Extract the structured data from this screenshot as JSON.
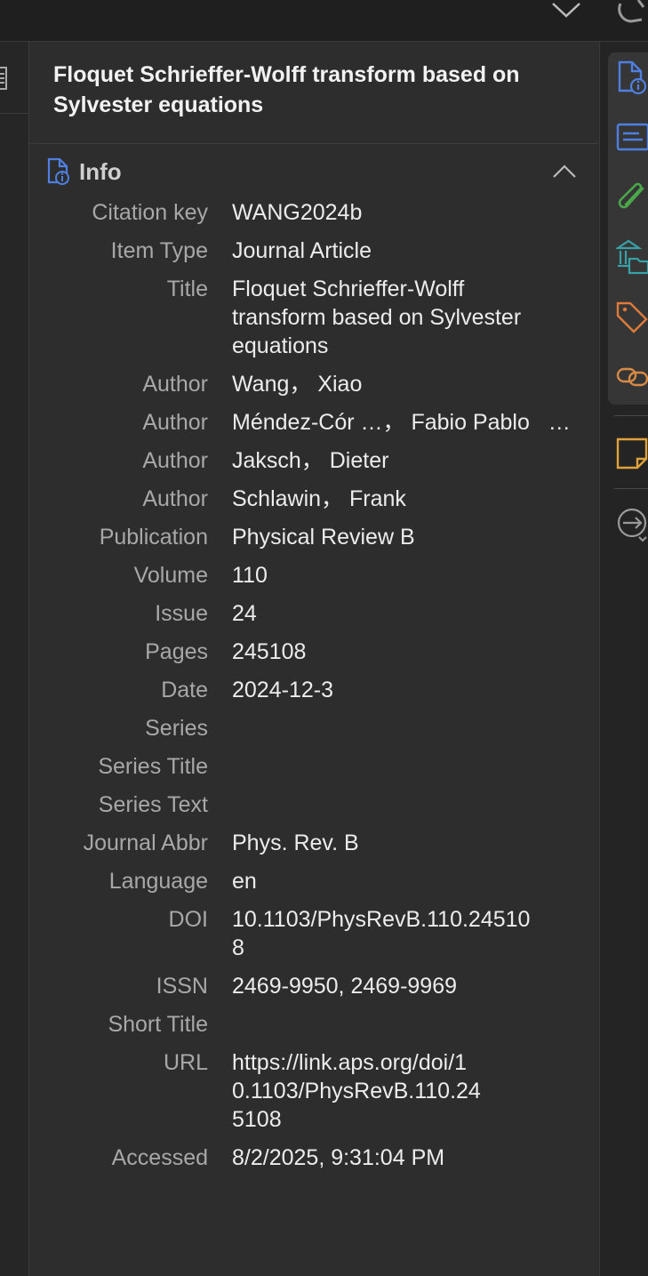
{
  "header": {
    "title": "Floquet Schrieffer-Wolff transform based on Sylvester equations"
  },
  "info_section": {
    "label": "Info",
    "rows": [
      {
        "key": "Citation key",
        "value": "WANG2024b"
      },
      {
        "key": "Item Type",
        "value": "Journal Article"
      },
      {
        "key": "Title",
        "value": "Floquet Schrieffer-Wolff transform based on Sylvester equations"
      },
      {
        "key": "Author",
        "value": "Wang， Xiao"
      },
      {
        "key": "Author",
        "value": "Méndez-Cór …， Fabio Pablo   …"
      },
      {
        "key": "Author",
        "value": "Jaksch， Dieter"
      },
      {
        "key": "Author",
        "value": "Schlawin， Frank"
      },
      {
        "key": "Publication",
        "value": "Physical Review B"
      },
      {
        "key": "Volume",
        "value": "110"
      },
      {
        "key": "Issue",
        "value": "24"
      },
      {
        "key": "Pages",
        "value": "245108"
      },
      {
        "key": "Date",
        "value": "2024-12-3"
      },
      {
        "key": "Series",
        "value": ""
      },
      {
        "key": "Series Title",
        "value": ""
      },
      {
        "key": "Series Text",
        "value": ""
      },
      {
        "key": "Journal Abbr",
        "value": "Phys. Rev. B"
      },
      {
        "key": "Language",
        "value": "en"
      },
      {
        "key": "DOI",
        "value": "10.1103/PhysRevB.110.245108"
      },
      {
        "key": "ISSN",
        "value": "2469-9950, 2469-9969"
      },
      {
        "key": "Short Title",
        "value": ""
      },
      {
        "key": "URL",
        "value": "https://link.aps.org/doi/10.1103/PhysRevB.110.245108"
      },
      {
        "key": "Accessed",
        "value": "8/2/2025, 9:31:04 PM"
      }
    ]
  },
  "right_rail": {
    "icons": [
      "info-icon",
      "abstract-icon",
      "attachments-icon",
      "libraries-collections-icon",
      "tags-icon",
      "related-icon",
      "notes-icon",
      "locate-icon"
    ]
  },
  "colors": {
    "background": "#2d2d2d",
    "accent_blue": "#4f7fe0",
    "attachment_green": "#4aa84a",
    "library_teal": "#3aa0a8",
    "tag_orange": "#e07a3a",
    "related_orange": "#d98b45",
    "note_yellow": "#e0a23a"
  }
}
